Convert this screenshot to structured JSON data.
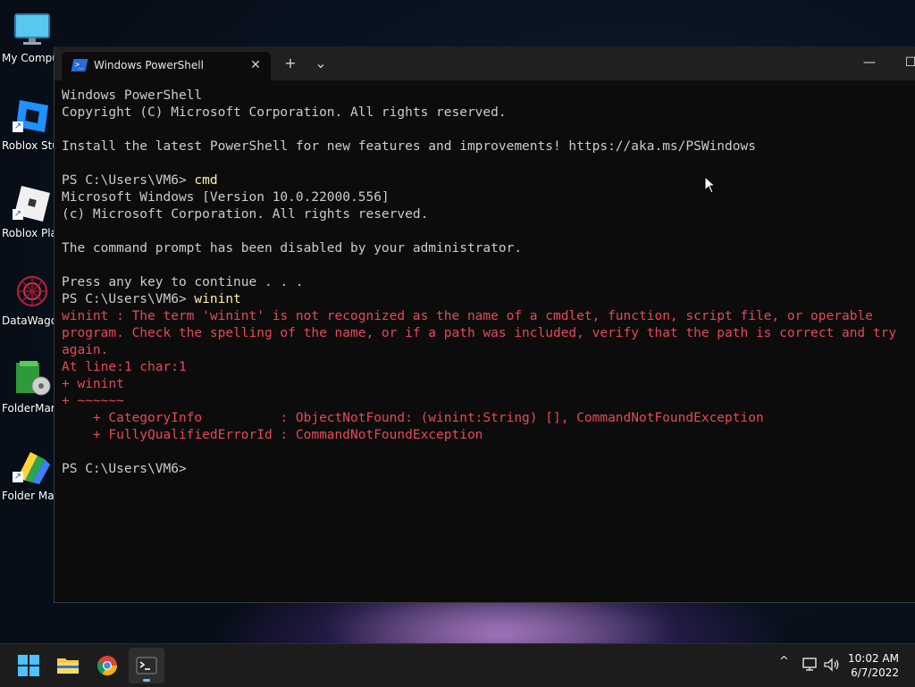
{
  "desktop": {
    "icons": [
      {
        "label": "My Compu",
        "icon": "monitor-icon"
      },
      {
        "label": "Roblox Stu",
        "icon": "roblox-studio-icon"
      },
      {
        "label": "Roblox Pla",
        "icon": "roblox-player-icon"
      },
      {
        "label": "DataWago",
        "icon": "datawagon-icon"
      },
      {
        "label": "FolderMar",
        "icon": "foldermarker-icon"
      },
      {
        "label": "Folder Mar",
        "icon": "folder-marker-icon"
      }
    ]
  },
  "window": {
    "tab_title": "Windows PowerShell",
    "tab_icon": "powershell-icon",
    "tab_close": "✕",
    "new_tab": "+",
    "dropdown": "⌄",
    "minimize": "—",
    "maximize": "☐"
  },
  "console": {
    "lines": [
      {
        "text": "Windows PowerShell",
        "style": "normal"
      },
      {
        "text": "Copyright (C) Microsoft Corporation. All rights reserved.",
        "style": "normal"
      },
      {
        "text": "",
        "style": "normal"
      },
      {
        "text": "Install the latest PowerShell for new features and improvements! https://aka.ms/PSWindows",
        "style": "normal"
      },
      {
        "text": "",
        "style": "normal"
      },
      {
        "prompt": "PS C:\\Users\\VM6> ",
        "command": "cmd",
        "style": "prompt"
      },
      {
        "text": "Microsoft Windows [Version 10.0.22000.556]",
        "style": "normal"
      },
      {
        "text": "(c) Microsoft Corporation. All rights reserved.",
        "style": "normal"
      },
      {
        "text": "",
        "style": "normal"
      },
      {
        "text": "The command prompt has been disabled by your administrator.",
        "style": "normal"
      },
      {
        "text": "",
        "style": "normal"
      },
      {
        "text": "Press any key to continue . . .",
        "style": "normal"
      },
      {
        "prompt": "PS C:\\Users\\VM6> ",
        "command": "winint",
        "style": "prompt"
      },
      {
        "text": "winint : The term 'winint' is not recognized as the name of a cmdlet, function, script file, or operable",
        "style": "error"
      },
      {
        "text": "program. Check the spelling of the name, or if a path was included, verify that the path is correct and try",
        "style": "error"
      },
      {
        "text": "again.",
        "style": "error"
      },
      {
        "text": "At line:1 char:1",
        "style": "error"
      },
      {
        "text": "+ winint",
        "style": "error"
      },
      {
        "text": "+ ~~~~~~",
        "style": "error"
      },
      {
        "text": "    + CategoryInfo          : ObjectNotFound: (winint:String) [], CommandNotFoundException",
        "style": "error"
      },
      {
        "text": "    + FullyQualifiedErrorId : CommandNotFoundException",
        "style": "error"
      },
      {
        "text": "",
        "style": "normal"
      },
      {
        "prompt": "PS C:\\Users\\VM6>",
        "command": "",
        "style": "prompt"
      }
    ]
  },
  "taskbar": {
    "apps": [
      {
        "name": "start-button",
        "icon": "windows-logo-icon"
      },
      {
        "name": "file-explorer",
        "icon": "folder-icon"
      },
      {
        "name": "chrome",
        "icon": "chrome-icon"
      },
      {
        "name": "terminal",
        "icon": "terminal-icon",
        "active": true
      }
    ],
    "tray": {
      "chevron": "^",
      "network": "network-icon",
      "volume": "volume-icon"
    },
    "clock": {
      "time": "10:02 AM",
      "date": "6/7/2022"
    }
  },
  "colors": {
    "console_bg": "#0c0c0c",
    "console_text": "#cccccc",
    "error_text": "#e74856",
    "command_text": "#f9f1a5",
    "titlebar": "#202020",
    "taskbar": "#1c1c1c"
  }
}
